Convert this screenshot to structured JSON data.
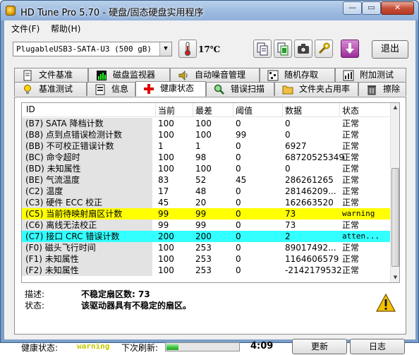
{
  "window": {
    "title": "HD Tune Pro 5.70 - 硬盘/固态硬盘实用程序"
  },
  "menu": {
    "items": [
      {
        "label": "文件(F)"
      },
      {
        "label": "帮助(H)"
      }
    ]
  },
  "toolbar": {
    "drive": "PlugableUSB3-SATA-U3 (500 gB)",
    "temperature": "17℃",
    "exit_label": "退出"
  },
  "tabs": {
    "row1": [
      {
        "label": "文件基准",
        "icon": "file-benchmark-icon"
      },
      {
        "label": "磁盘监视器",
        "icon": "disk-monitor-icon"
      },
      {
        "label": "自动噪音管理",
        "icon": "speaker-icon"
      },
      {
        "label": "随机存取",
        "icon": "random-access-icon"
      },
      {
        "label": "附加测试",
        "icon": "extra-tests-icon"
      }
    ],
    "row2": [
      {
        "label": "基准测试",
        "icon": "lightbulb-icon"
      },
      {
        "label": "信息",
        "icon": "info-icon"
      },
      {
        "label": "健康状态",
        "icon": "health-cross-icon"
      },
      {
        "label": "错误扫描",
        "icon": "magnifier-icon"
      },
      {
        "label": "文件夹占用率",
        "icon": "folder-icon"
      },
      {
        "label": "擦除",
        "icon": "trash-icon"
      }
    ],
    "active": "健康状态"
  },
  "smart": {
    "columns": [
      "ID",
      "当前",
      "最差",
      "阈值",
      "数据",
      "状态"
    ],
    "rows": [
      {
        "id": "(B7) SATA 降档计数",
        "current": "100",
        "worst": "100",
        "threshold": "0",
        "data": "0",
        "status": "正常",
        "highlight": ""
      },
      {
        "id": "(B8) 点到点错误检测计数",
        "current": "100",
        "worst": "100",
        "threshold": "99",
        "data": "0",
        "status": "正常",
        "highlight": ""
      },
      {
        "id": "(BB) 不可校正错误计数",
        "current": "1",
        "worst": "1",
        "threshold": "0",
        "data": "6927",
        "status": "正常",
        "highlight": ""
      },
      {
        "id": "(BC) 命令超时",
        "current": "100",
        "worst": "98",
        "threshold": "0",
        "data": "68720525349",
        "status": "正常",
        "highlight": ""
      },
      {
        "id": "(BD) 未知属性",
        "current": "100",
        "worst": "100",
        "threshold": "0",
        "data": "0",
        "status": "正常",
        "highlight": ""
      },
      {
        "id": "(BE) 气流温度",
        "current": "83",
        "worst": "52",
        "threshold": "45",
        "data": "286261265",
        "status": "正常",
        "highlight": ""
      },
      {
        "id": "(C2) 温度",
        "current": "17",
        "worst": "48",
        "threshold": "0",
        "data": "28146209...",
        "status": "正常",
        "highlight": ""
      },
      {
        "id": "(C3) 硬件 ECC 校正",
        "current": "45",
        "worst": "20",
        "threshold": "0",
        "data": "162663520",
        "status": "正常",
        "highlight": ""
      },
      {
        "id": "(C5) 当前待映射扇区计数",
        "current": "99",
        "worst": "99",
        "threshold": "0",
        "data": "73",
        "status": "warning",
        "highlight": "yellow"
      },
      {
        "id": "(C6) 离线无法校正",
        "current": "99",
        "worst": "99",
        "threshold": "0",
        "data": "73",
        "status": "正常",
        "highlight": ""
      },
      {
        "id": "(C7) 接口 CRC 错误计数",
        "current": "200",
        "worst": "200",
        "threshold": "0",
        "data": "2",
        "status": "atten...",
        "highlight": "cyan"
      },
      {
        "id": "(F0) 磁头飞行时间",
        "current": "100",
        "worst": "253",
        "threshold": "0",
        "data": "89017492...",
        "status": "正常",
        "highlight": ""
      },
      {
        "id": "(F1) 未知属性",
        "current": "100",
        "worst": "253",
        "threshold": "0",
        "data": "1164606579",
        "status": "正常",
        "highlight": ""
      },
      {
        "id": "(F2) 未知属性",
        "current": "100",
        "worst": "253",
        "threshold": "0",
        "data": "-2142179532",
        "status": "正常",
        "highlight": ""
      }
    ]
  },
  "details": {
    "desc_label": "描述:",
    "desc_value": "不稳定扇区数: 73",
    "state_label": "状态:",
    "state_value": "该驱动器具有不稳定的扇区。"
  },
  "status": {
    "health_label": "健康状态:",
    "health_value": "warning",
    "refresh_label": "下次刷新:",
    "refresh_progress": 0.17,
    "countdown": "4:09",
    "update_label": "更新",
    "log_label": "日志"
  },
  "colors": {
    "highlight_yellow": "#ffff00",
    "highlight_cyan": "#33ffff",
    "warning_text": "#c8c800"
  }
}
